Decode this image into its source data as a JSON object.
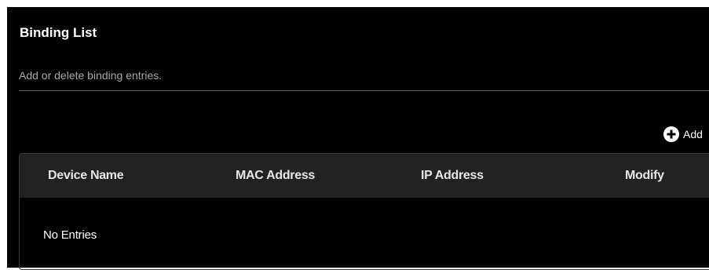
{
  "section": {
    "title": "Binding List",
    "description": "Add or delete binding entries."
  },
  "toolbar": {
    "add_label": "Add",
    "add_icon": "plus-circle-icon"
  },
  "table": {
    "columns": [
      "Device Name",
      "MAC Address",
      "IP Address",
      "Modify"
    ],
    "rows": [],
    "empty_text": "No Entries"
  },
  "colors": {
    "background": "#000000",
    "header_background": "#222222",
    "text": "#ffffff",
    "muted_text": "#a6a6a6"
  }
}
